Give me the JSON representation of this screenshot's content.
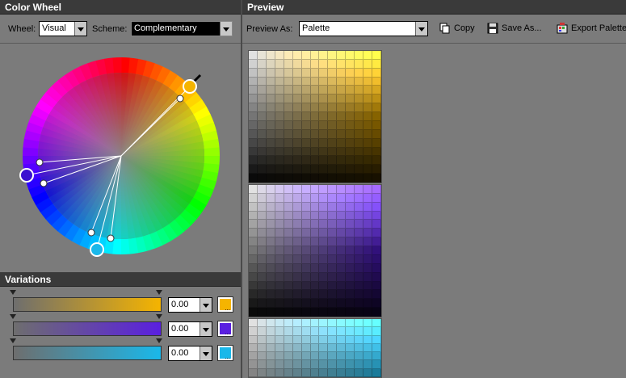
{
  "color_wheel_panel": {
    "title": "Color Wheel",
    "wheel_label": "Wheel:",
    "wheel_value": "Visual",
    "scheme_label": "Scheme:",
    "scheme_value": "Complementary"
  },
  "preview_panel": {
    "title": "Preview",
    "preview_as_label": "Preview As:",
    "preview_as_value": "Palette",
    "copy_label": "Copy",
    "save_as_label": "Save As...",
    "export_label": "Export Palette"
  },
  "variations": {
    "title": "Variations",
    "rows": [
      {
        "value": "0.00",
        "color": "#f5b400"
      },
      {
        "value": "0.00",
        "color": "#5a1fe0"
      },
      {
        "value": "0.00",
        "color": "#1ab8ea"
      }
    ],
    "swatch_glyph": "..."
  },
  "palettes": [
    {
      "name": "orange",
      "color": "#f5b400"
    },
    {
      "name": "violet",
      "color": "#5a1fe0"
    },
    {
      "name": "cyan",
      "color": "#1ab8ea"
    }
  ],
  "icons": {
    "copy": "copy-icon",
    "save": "floppy-disk-icon",
    "export": "export-palette-icon"
  }
}
